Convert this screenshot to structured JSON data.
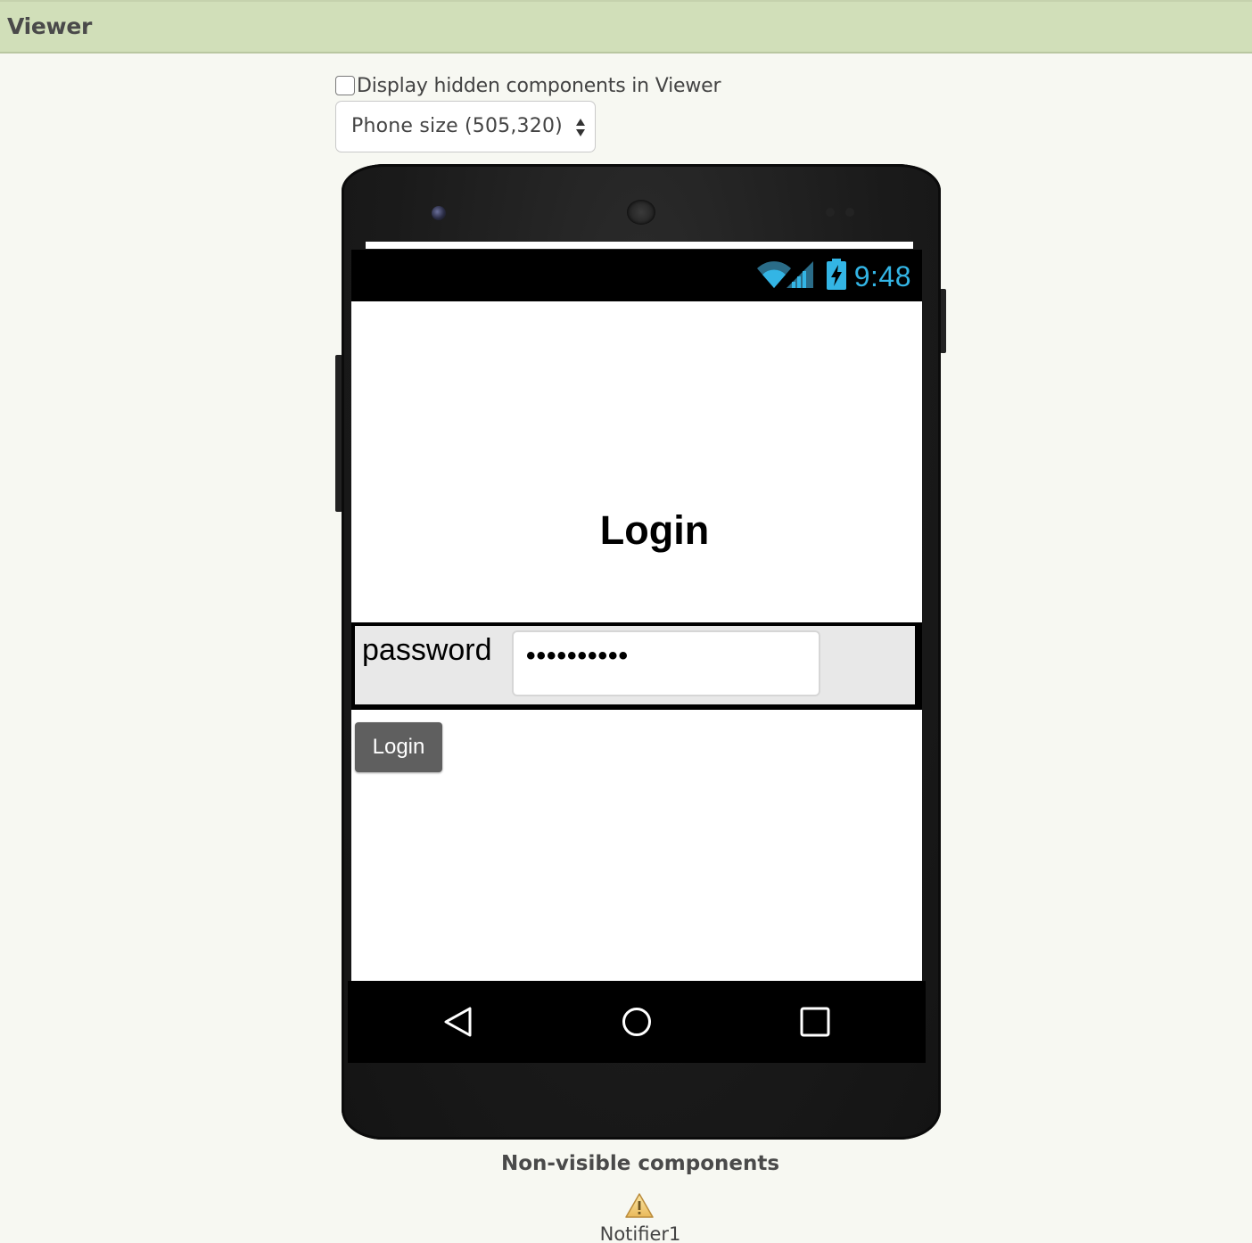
{
  "viewer": {
    "title": "Viewer"
  },
  "options": {
    "hidden_components_label": "Display hidden components in Viewer",
    "hidden_components_checked": false,
    "phone_size_selected": "Phone size (505,320)"
  },
  "status_bar": {
    "time": "9:48",
    "icons": [
      "wifi-icon",
      "signal-icon",
      "battery-charging-icon"
    ],
    "accent_color": "#33b5e5"
  },
  "screen": {
    "heading": "Login",
    "password_label": "password",
    "password_value": "••••••••••",
    "login_button_label": "Login"
  },
  "nav_bar": {
    "icons": [
      "back-icon",
      "home-icon",
      "recents-icon"
    ]
  },
  "non_visible": {
    "title": "Non-visible components",
    "items": [
      {
        "label": "Notifier1",
        "icon": "warning-icon"
      }
    ]
  },
  "colors": {
    "header_background": "#d1dfb9",
    "page_background": "#f7f8f2",
    "button_background": "#5f5f5f"
  }
}
